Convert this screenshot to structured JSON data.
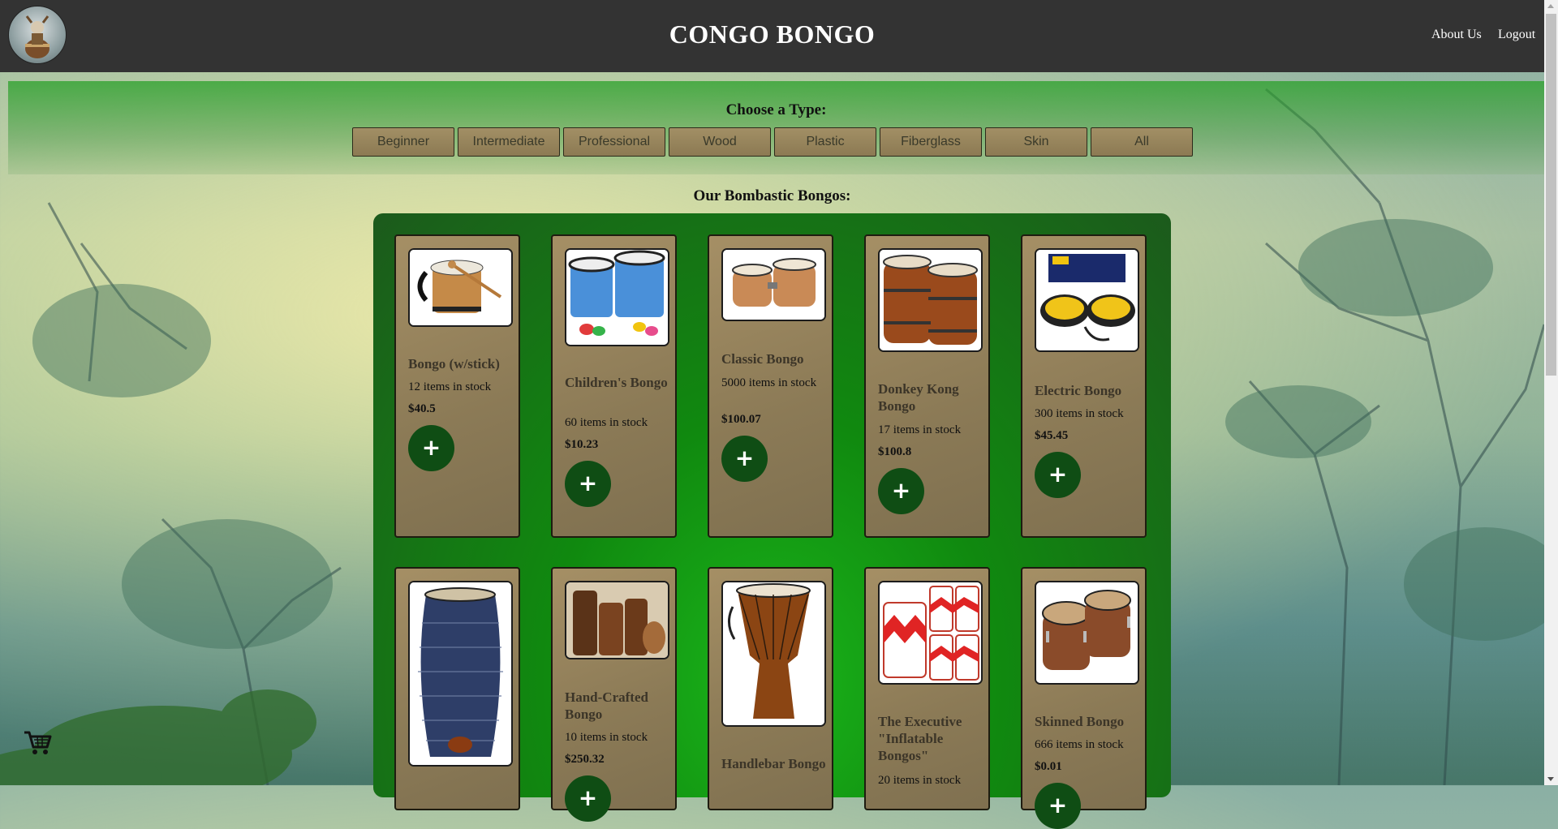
{
  "header": {
    "title": "CONGO BONGO",
    "nav": [
      {
        "label": "About Us"
      },
      {
        "label": "Logout"
      }
    ]
  },
  "filters": {
    "heading": "Choose a Type:",
    "types": [
      "Beginner",
      "Intermediate",
      "Professional",
      "Wood",
      "Plastic",
      "Fiberglass",
      "Skin",
      "All"
    ]
  },
  "catalog": {
    "heading": "Our Bombastic Bongos:",
    "add_label": "+",
    "products": [
      {
        "name": "Bongo (w/stick)",
        "stock": "12 items in stock",
        "price": "$40.5"
      },
      {
        "name": "Children's Bongo",
        "stock": "60 items in stock",
        "price": "$10.23"
      },
      {
        "name": "Classic Bongo",
        "stock": "5000 items in stock",
        "price": "$100.07"
      },
      {
        "name": "Donkey Kong Bongo",
        "stock": "17 items in stock",
        "price": "$100.8"
      },
      {
        "name": "Electric Bongo",
        "stock": "300 items in stock",
        "price": "$45.45"
      },
      {
        "name": "",
        "stock": "",
        "price": ""
      },
      {
        "name": "Hand-Crafted Bongo",
        "stock": "10 items in stock",
        "price": "$250.32"
      },
      {
        "name": "Handlebar Bongo",
        "stock": "",
        "price": ""
      },
      {
        "name": "The Executive \"Inflatable Bongos\"",
        "stock": "20 items in stock",
        "price": ""
      },
      {
        "name": "Skinned Bongo",
        "stock": "666 items in stock",
        "price": "$0.01"
      }
    ]
  },
  "colors": {
    "topbar": "#333333",
    "card": "#a58f65",
    "add_button": "#0f4d14",
    "panel_green": "#10890f"
  },
  "icons": {
    "logo": "goat-drummer-logo",
    "cart": "shopping-cart-icon",
    "add": "plus-icon"
  }
}
